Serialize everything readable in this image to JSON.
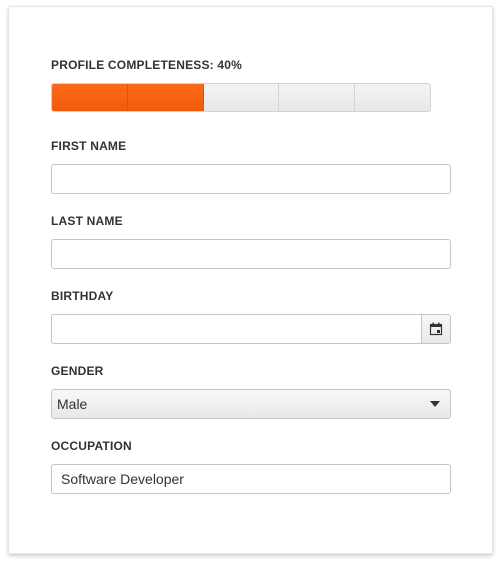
{
  "profile": {
    "completeness_label": "PROFILE COMPLETENESS: 40%",
    "completeness_fraction": 0.4,
    "segments": 5,
    "accent_color": "#f25b0b"
  },
  "form": {
    "first_name": {
      "label": "FIRST NAME",
      "value": ""
    },
    "last_name": {
      "label": "LAST NAME",
      "value": ""
    },
    "birthday": {
      "label": "BIRTHDAY",
      "value": "",
      "icon": "calendar-icon"
    },
    "gender": {
      "label": "GENDER",
      "value": "Male",
      "icon": "caret-down-icon"
    },
    "occupation": {
      "label": "OCCUPATION",
      "value": "Software Developer"
    }
  }
}
